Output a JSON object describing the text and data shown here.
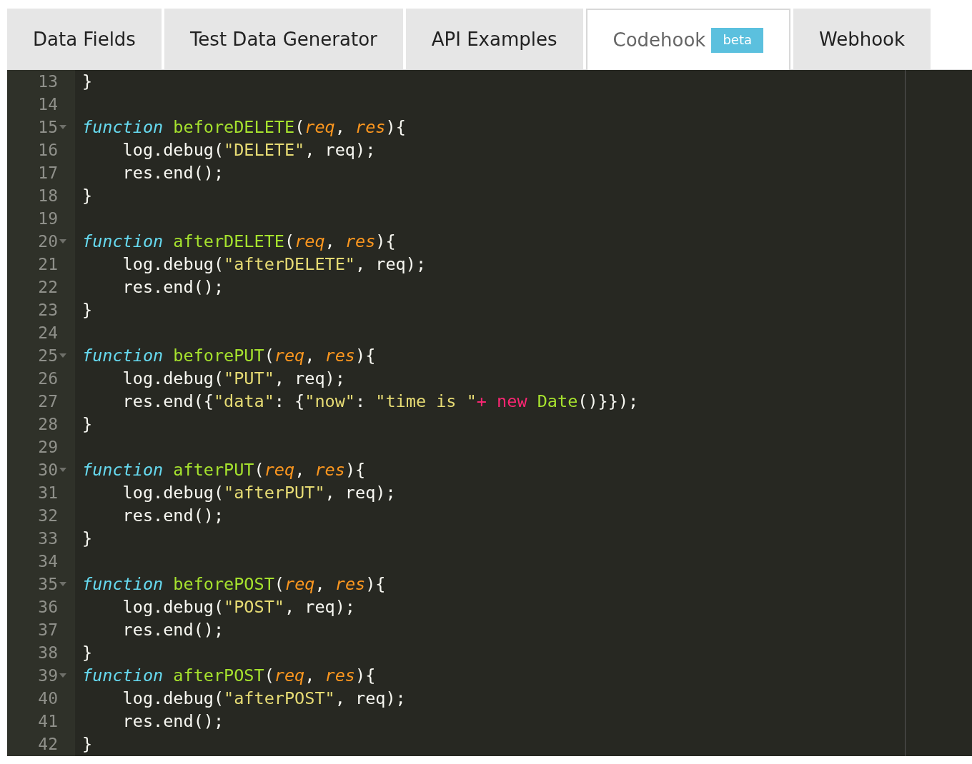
{
  "tabs": [
    {
      "label": "Data Fields",
      "selected": false
    },
    {
      "label": "Test Data Generator",
      "selected": false
    },
    {
      "label": "API Examples",
      "selected": false
    },
    {
      "label": "Codehook",
      "selected": true,
      "badge": "beta"
    },
    {
      "label": "Webhook",
      "selected": false
    }
  ],
  "editor": {
    "lines": [
      {
        "number": "13",
        "foldable": false,
        "tokens": [
          {
            "text": "}",
            "kind": "plain"
          }
        ]
      },
      {
        "number": "14",
        "foldable": false
      },
      {
        "number": "15",
        "foldable": true,
        "tokens": [
          {
            "text": "function",
            "kind": "keyword"
          },
          {
            "text": " beforeDELETE",
            "kind": "function"
          },
          {
            "text": "(",
            "kind": "plain"
          },
          {
            "text": "req",
            "kind": "param"
          },
          {
            "text": ", ",
            "kind": "plain"
          },
          {
            "text": "res",
            "kind": "param"
          },
          {
            "text": "){",
            "kind": "plain"
          }
        ]
      },
      {
        "number": "16",
        "foldable": false,
        "tokens": [
          {
            "text": "    log.debug(",
            "kind": "plain"
          },
          {
            "text": "\"DELETE\"",
            "kind": "string"
          },
          {
            "text": ", req);",
            "kind": "plain"
          }
        ]
      },
      {
        "number": "17",
        "foldable": false,
        "tokens": [
          {
            "text": "    res.end();",
            "kind": "plain"
          }
        ]
      },
      {
        "number": "18",
        "foldable": false,
        "tokens": [
          {
            "text": "}",
            "kind": "plain"
          }
        ]
      },
      {
        "number": "19",
        "foldable": false
      },
      {
        "number": "20",
        "foldable": true,
        "tokens": [
          {
            "text": "function",
            "kind": "keyword"
          },
          {
            "text": " afterDELETE",
            "kind": "function"
          },
          {
            "text": "(",
            "kind": "plain"
          },
          {
            "text": "req",
            "kind": "param"
          },
          {
            "text": ", ",
            "kind": "plain"
          },
          {
            "text": "res",
            "kind": "param"
          },
          {
            "text": "){",
            "kind": "plain"
          }
        ]
      },
      {
        "number": "21",
        "foldable": false,
        "tokens": [
          {
            "text": "    log.debug(",
            "kind": "plain"
          },
          {
            "text": "\"afterDELETE\"",
            "kind": "string"
          },
          {
            "text": ", req);",
            "kind": "plain"
          }
        ]
      },
      {
        "number": "22",
        "foldable": false,
        "tokens": [
          {
            "text": "    res.end();",
            "kind": "plain"
          }
        ]
      },
      {
        "number": "23",
        "foldable": false,
        "tokens": [
          {
            "text": "}",
            "kind": "plain"
          }
        ]
      },
      {
        "number": "24",
        "foldable": false
      },
      {
        "number": "25",
        "foldable": true,
        "tokens": [
          {
            "text": "function",
            "kind": "keyword"
          },
          {
            "text": " beforePUT",
            "kind": "function"
          },
          {
            "text": "(",
            "kind": "plain"
          },
          {
            "text": "req",
            "kind": "param"
          },
          {
            "text": ", ",
            "kind": "plain"
          },
          {
            "text": "res",
            "kind": "param"
          },
          {
            "text": "){",
            "kind": "plain"
          }
        ]
      },
      {
        "number": "26",
        "foldable": false,
        "tokens": [
          {
            "text": "    log.debug(",
            "kind": "plain"
          },
          {
            "text": "\"PUT\"",
            "kind": "string"
          },
          {
            "text": ", req);",
            "kind": "plain"
          }
        ]
      },
      {
        "number": "27",
        "foldable": false,
        "tokens": [
          {
            "text": "    res.end({",
            "kind": "plain"
          },
          {
            "text": "\"data\"",
            "kind": "string"
          },
          {
            "text": ": {",
            "kind": "plain"
          },
          {
            "text": "\"now\"",
            "kind": "string"
          },
          {
            "text": ": ",
            "kind": "plain"
          },
          {
            "text": "\"time is \"",
            "kind": "string"
          },
          {
            "text": "+",
            "kind": "operator"
          },
          {
            "text": " new",
            "kind": "operator"
          },
          {
            "text": " Date",
            "kind": "function"
          },
          {
            "text": "()}});",
            "kind": "plain"
          }
        ]
      },
      {
        "number": "28",
        "foldable": false,
        "tokens": [
          {
            "text": "}",
            "kind": "plain"
          }
        ]
      },
      {
        "number": "29",
        "foldable": false
      },
      {
        "number": "30",
        "foldable": true,
        "tokens": [
          {
            "text": "function",
            "kind": "keyword"
          },
          {
            "text": " afterPUT",
            "kind": "function"
          },
          {
            "text": "(",
            "kind": "plain"
          },
          {
            "text": "req",
            "kind": "param"
          },
          {
            "text": ", ",
            "kind": "plain"
          },
          {
            "text": "res",
            "kind": "param"
          },
          {
            "text": "){",
            "kind": "plain"
          }
        ]
      },
      {
        "number": "31",
        "foldable": false,
        "tokens": [
          {
            "text": "    log.debug(",
            "kind": "plain"
          },
          {
            "text": "\"afterPUT\"",
            "kind": "string"
          },
          {
            "text": ", req);",
            "kind": "plain"
          }
        ]
      },
      {
        "number": "32",
        "foldable": false,
        "tokens": [
          {
            "text": "    res.end();",
            "kind": "plain"
          }
        ]
      },
      {
        "number": "33",
        "foldable": false,
        "tokens": [
          {
            "text": "}",
            "kind": "plain"
          }
        ]
      },
      {
        "number": "34",
        "foldable": false
      },
      {
        "number": "35",
        "foldable": true,
        "tokens": [
          {
            "text": "function",
            "kind": "keyword"
          },
          {
            "text": " beforePOST",
            "kind": "function"
          },
          {
            "text": "(",
            "kind": "plain"
          },
          {
            "text": "req",
            "kind": "param"
          },
          {
            "text": ", ",
            "kind": "plain"
          },
          {
            "text": "res",
            "kind": "param"
          },
          {
            "text": "){",
            "kind": "plain"
          }
        ]
      },
      {
        "number": "36",
        "foldable": false,
        "tokens": [
          {
            "text": "    log.debug(",
            "kind": "plain"
          },
          {
            "text": "\"POST\"",
            "kind": "string"
          },
          {
            "text": ", req);",
            "kind": "plain"
          }
        ]
      },
      {
        "number": "37",
        "foldable": false,
        "tokens": [
          {
            "text": "    res.end();",
            "kind": "plain"
          }
        ]
      },
      {
        "number": "38",
        "foldable": false,
        "tokens": [
          {
            "text": "}",
            "kind": "plain"
          }
        ]
      },
      {
        "number": "39",
        "foldable": true,
        "tokens": [
          {
            "text": "function",
            "kind": "keyword"
          },
          {
            "text": " afterPOST",
            "kind": "function"
          },
          {
            "text": "(",
            "kind": "plain"
          },
          {
            "text": "req",
            "kind": "param"
          },
          {
            "text": ", ",
            "kind": "plain"
          },
          {
            "text": "res",
            "kind": "param"
          },
          {
            "text": "){",
            "kind": "plain"
          }
        ]
      },
      {
        "number": "40",
        "foldable": false,
        "tokens": [
          {
            "text": "    log.debug(",
            "kind": "plain"
          },
          {
            "text": "\"afterPOST\"",
            "kind": "string"
          },
          {
            "text": ", req);",
            "kind": "plain"
          }
        ]
      },
      {
        "number": "41",
        "foldable": false,
        "tokens": [
          {
            "text": "    res.end();",
            "kind": "plain"
          }
        ]
      },
      {
        "number": "42",
        "foldable": false,
        "tokens": [
          {
            "text": "}",
            "kind": "plain"
          }
        ]
      }
    ]
  }
}
